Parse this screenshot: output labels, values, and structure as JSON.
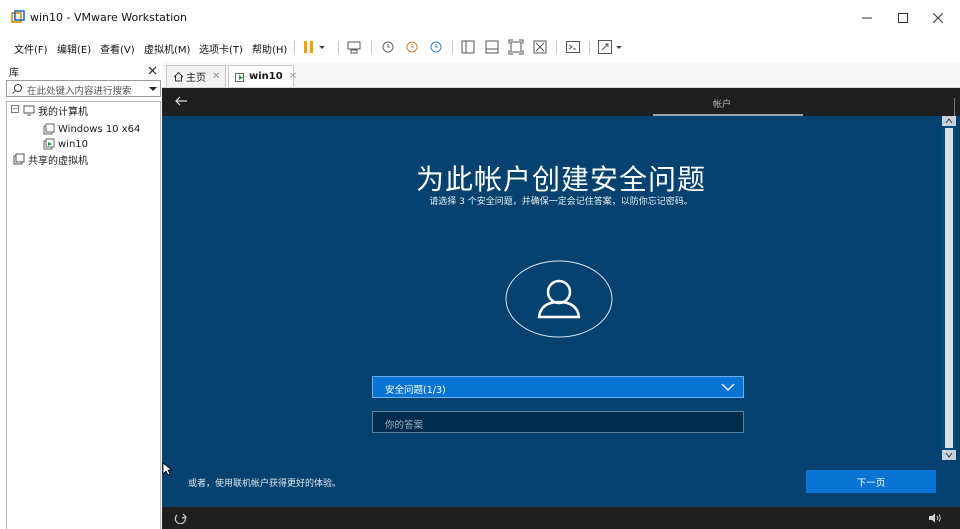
{
  "window": {
    "title": "win10 - VMware Workstation",
    "controls": [
      "minimize",
      "maximize",
      "close"
    ]
  },
  "menu": {
    "items": [
      "文件(F)",
      "编辑(E)",
      "查看(V)",
      "虚拟机(M)",
      "选项卡(T)",
      "帮助(H)"
    ]
  },
  "library": {
    "title": "库",
    "search_placeholder": "在此处键入内容进行搜索",
    "tree": {
      "root_label": "我的计算机",
      "vms": [
        "Windows 10 x64",
        "win10"
      ],
      "shared_label": "共享的虚拟机"
    }
  },
  "tabs": [
    {
      "label": "主页",
      "active": false
    },
    {
      "label": "win10",
      "active": true
    }
  ],
  "vm_screen": {
    "top_tab": "帐户",
    "heading": "为此帐户创建安全问题",
    "subheading": "请选择 3 个安全问题，并确保一定会记住答案，以防你忘记密码。",
    "dropdown_value": "安全问题(1/3)",
    "answer_placeholder": "你的答案",
    "alt_link": "或者，使用联机帐户获得更好的体验。",
    "next_button": "下一页",
    "colors": {
      "background": "#06426f",
      "accent": "#0a74d4",
      "bar": "#1f1f1f"
    }
  },
  "icons": {
    "search": "search-icon",
    "back": "back-arrow-icon",
    "user": "user-avatar-icon",
    "chevron": "chevron-down-icon",
    "ease_of_access": "ease-of-access-icon",
    "volume": "volume-icon"
  }
}
